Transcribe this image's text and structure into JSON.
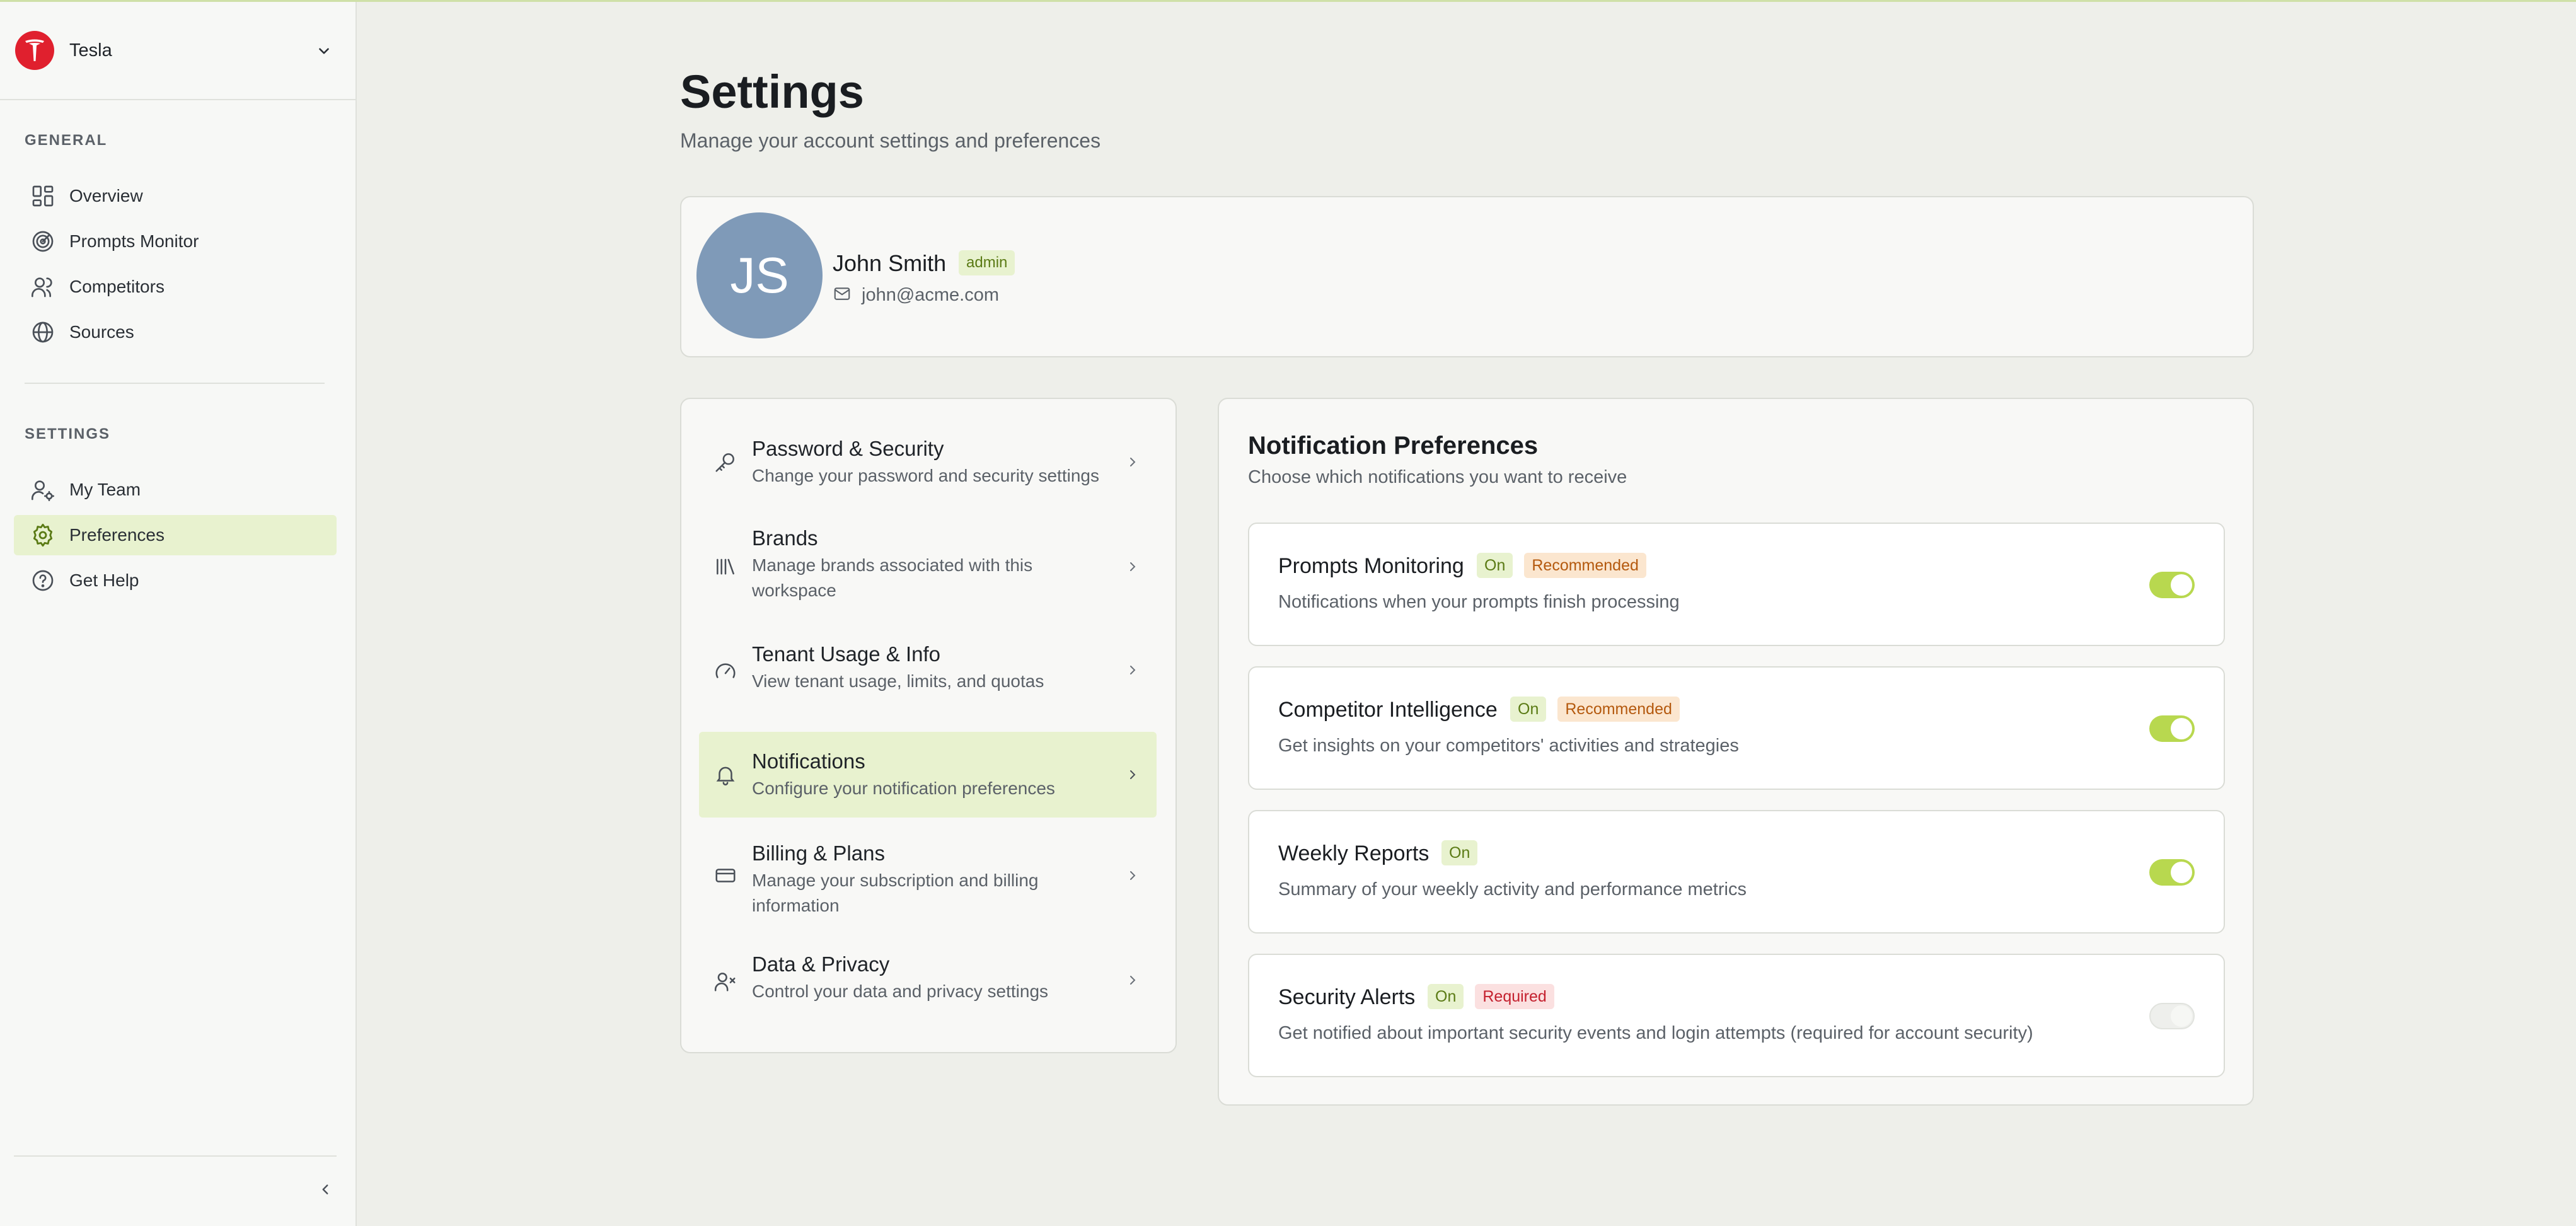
{
  "workspace": {
    "name": "Tesla"
  },
  "sidebar": {
    "general_label": "GENERAL",
    "general_items": [
      {
        "label": "Overview",
        "icon": "grid-icon"
      },
      {
        "label": "Prompts Monitor",
        "icon": "radar-icon"
      },
      {
        "label": "Competitors",
        "icon": "users-icon"
      },
      {
        "label": "Sources",
        "icon": "globe-icon"
      }
    ],
    "settings_label": "SETTINGS",
    "settings_items": [
      {
        "label": "My Team",
        "icon": "user-gear-icon"
      },
      {
        "label": "Preferences",
        "icon": "gear-icon",
        "active": true
      },
      {
        "label": "Get Help",
        "icon": "help-circle-icon"
      }
    ]
  },
  "page": {
    "title": "Settings",
    "subtitle": "Manage your account settings and preferences"
  },
  "profile": {
    "initials": "JS",
    "name": "John Smith",
    "role": "admin",
    "email": "john@acme.com"
  },
  "menu": [
    {
      "title": "Password & Security",
      "desc": "Change your password and security settings",
      "icon": "key-icon"
    },
    {
      "title": "Brands",
      "desc": "Manage brands associated with this workspace",
      "icon": "library-icon"
    },
    {
      "title": "Tenant Usage & Info",
      "desc": "View tenant usage, limits, and quotas",
      "icon": "gauge-icon"
    },
    {
      "title": "Notifications",
      "desc": "Configure your notification preferences",
      "icon": "bell-icon",
      "active": true
    },
    {
      "title": "Billing & Plans",
      "desc": "Manage your subscription and billing information",
      "icon": "credit-card-icon"
    },
    {
      "title": "Data & Privacy",
      "desc": "Control your data and privacy settings",
      "icon": "user-x-icon"
    }
  ],
  "notifications": {
    "title": "Notification Preferences",
    "subtitle": "Choose which notifications you want to receive",
    "items": [
      {
        "title": "Prompts Monitoring",
        "status": "On",
        "tag": "Recommended",
        "desc": "Notifications when your prompts finish processing",
        "enabled": true
      },
      {
        "title": "Competitor Intelligence",
        "status": "On",
        "tag": "Recommended",
        "desc": "Get insights on your competitors' activities and strategies",
        "enabled": true
      },
      {
        "title": "Weekly Reports",
        "status": "On",
        "tag": "",
        "desc": "Summary of your weekly activity and performance metrics",
        "enabled": true
      },
      {
        "title": "Security Alerts",
        "status": "On",
        "tag": "Required",
        "desc": "Get notified about important security events and login attempts (required for account security)",
        "enabled": true,
        "locked": true
      }
    ]
  },
  "colors": {
    "accent": "#b8d84f",
    "active_bg": "#e8f2cf",
    "brand": "#e0202e"
  }
}
